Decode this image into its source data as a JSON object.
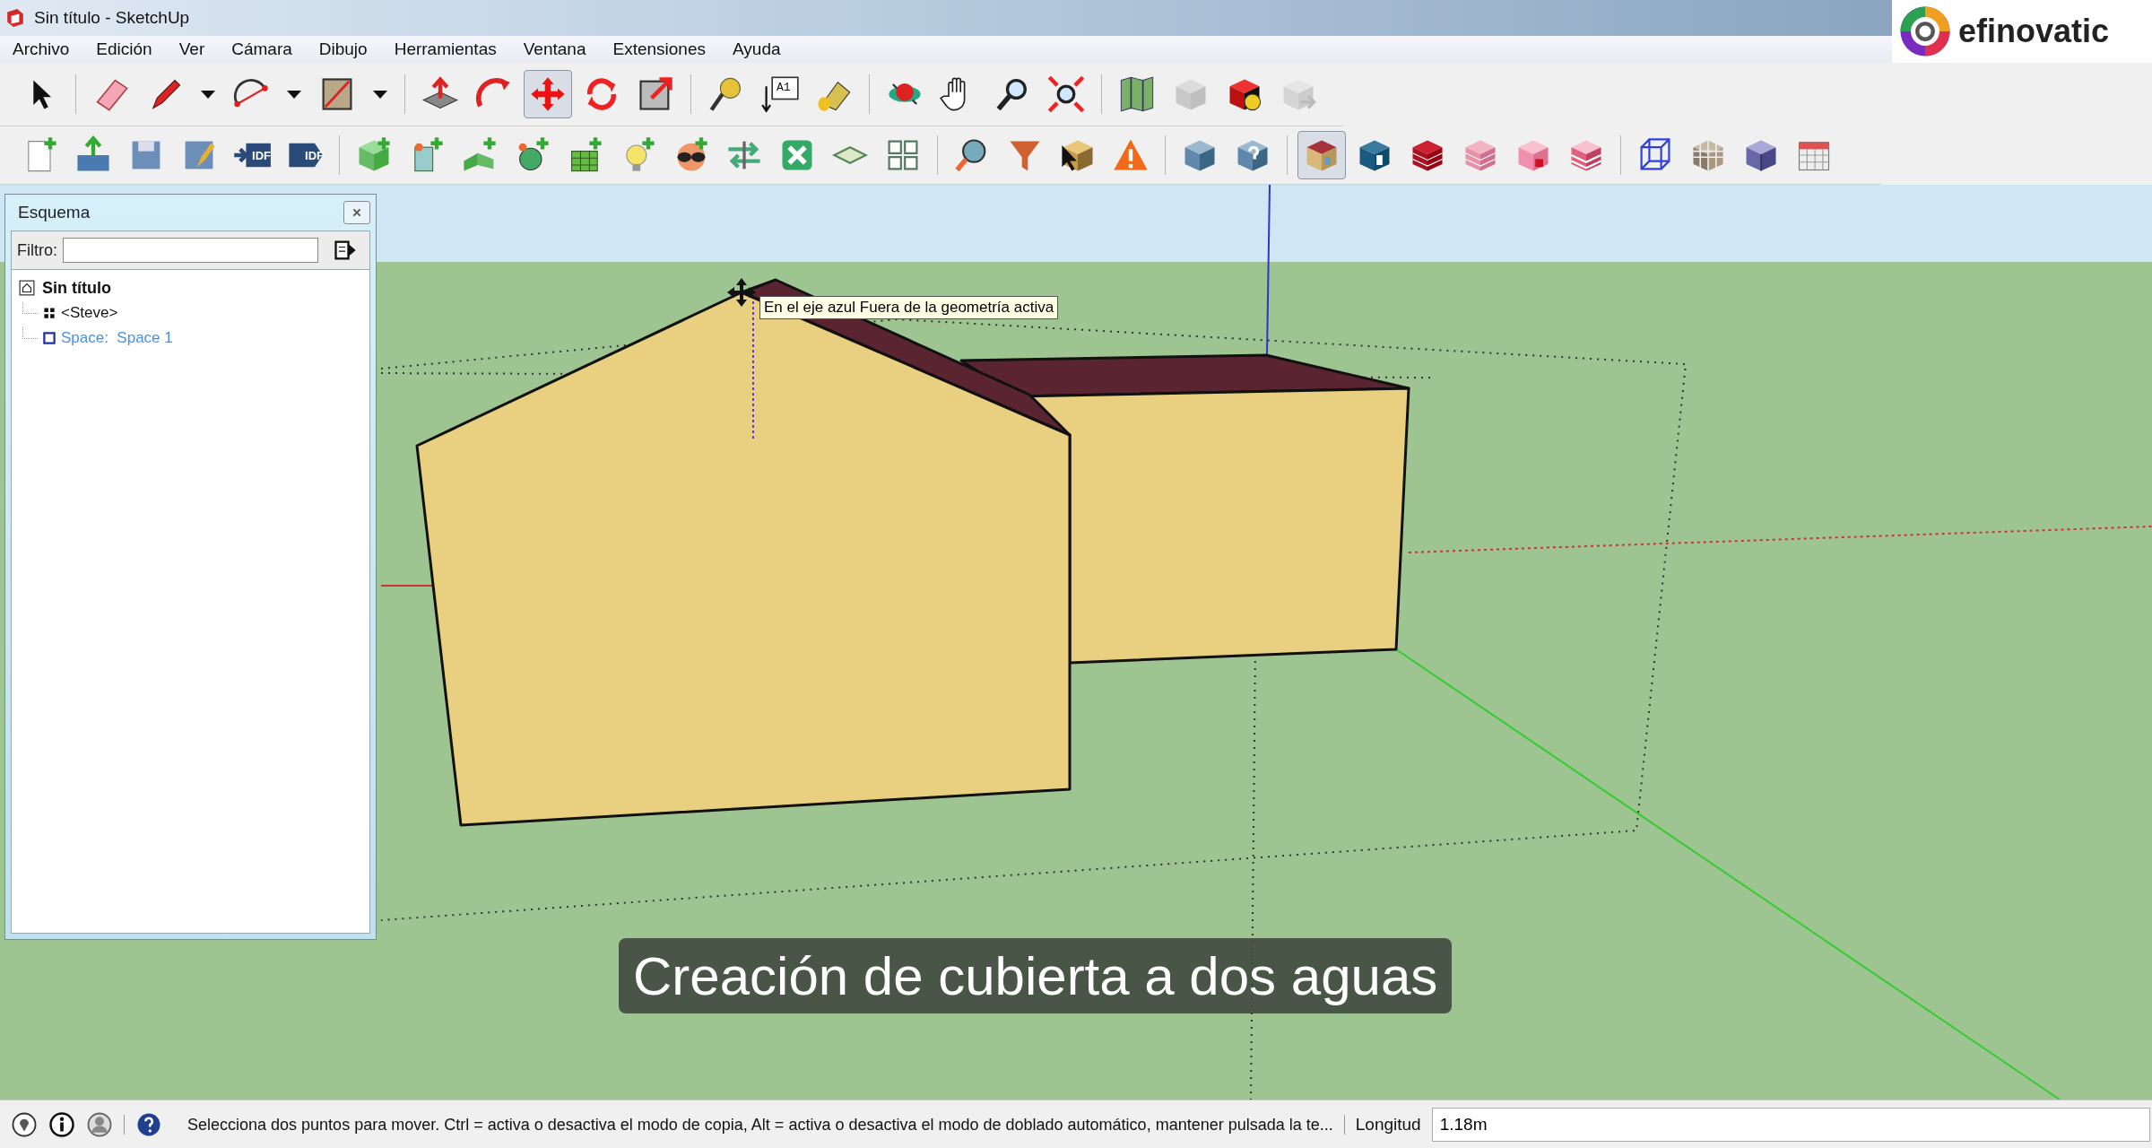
{
  "window": {
    "title": "Sin título - SketchUp"
  },
  "logo": {
    "text": "efinovatic"
  },
  "menu": [
    "Archivo",
    "Edición",
    "Ver",
    "Cámara",
    "Dibujo",
    "Herramientas",
    "Ventana",
    "Extensiones",
    "Ayuda"
  ],
  "toolbars": [
    {
      "buttons": [
        {
          "selected": false
        },
        {
          "selected": false
        },
        {
          "selected": false
        },
        {
          "selected": false
        },
        {
          "selected": false
        },
        {
          "selected": false
        },
        {
          "selected": false
        },
        {
          "selected": false
        },
        {
          "selected": false
        },
        {
          "selected": false
        },
        {
          "selected": true
        },
        {
          "selected": false
        },
        {
          "selected": false
        },
        {
          "selected": false
        },
        {
          "selected": false,
          "label": "A1"
        },
        {
          "selected": false
        },
        {
          "selected": false
        },
        {
          "selected": false
        },
        {
          "selected": false
        },
        {
          "selected": false
        },
        {
          "selected": false
        },
        {
          "selected": false
        },
        {
          "selected": false
        },
        {
          "selected": false
        }
      ]
    },
    {
      "buttons": [
        {
          "selected": false
        },
        {
          "selected": false
        },
        {
          "selected": false
        },
        {
          "selected": false
        },
        {
          "selected": false,
          "label": "IDF"
        },
        {
          "selected": false,
          "label": "IDF"
        },
        {
          "selected": false
        },
        {
          "selected": false
        },
        {
          "selected": false
        },
        {
          "selected": false
        },
        {
          "selected": false
        },
        {
          "selected": false
        },
        {
          "selected": false
        },
        {
          "selected": false
        },
        {
          "selected": false
        },
        {
          "selected": false
        },
        {
          "selected": false
        },
        {
          "selected": false
        },
        {
          "selected": false
        },
        {
          "selected": false
        },
        {
          "selected": false
        },
        {
          "selected": false
        },
        {
          "selected": false
        },
        {
          "selected": true
        },
        {
          "selected": false
        },
        {
          "selected": false
        },
        {
          "selected": false
        },
        {
          "selected": false
        },
        {
          "selected": false
        },
        {
          "selected": false
        },
        {
          "selected": false
        },
        {
          "selected": false
        },
        {
          "selected": false
        }
      ]
    }
  ],
  "outline_panel": {
    "title": "Esquema",
    "filter_label": "Filtro:",
    "tree": {
      "label": "Sin título",
      "kind": "model",
      "children": [
        {
          "label": "<Steve>",
          "kind": "component"
        },
        {
          "label": "Space:  Space 1",
          "kind": "space"
        }
      ]
    }
  },
  "viewport": {
    "tooltip": "En el eje azul Fuera de la geometría activa",
    "caption": "Creación de cubierta a dos aguas"
  },
  "status_bar": {
    "message": "Selecciona dos puntos para mover. Ctrl = activa o desactiva el modo de copia, Alt = activa o desactiva el modo de doblado automático, mantener pulsada la te...",
    "measurement_label": "Longitud",
    "measurement_value": "1.18m"
  }
}
